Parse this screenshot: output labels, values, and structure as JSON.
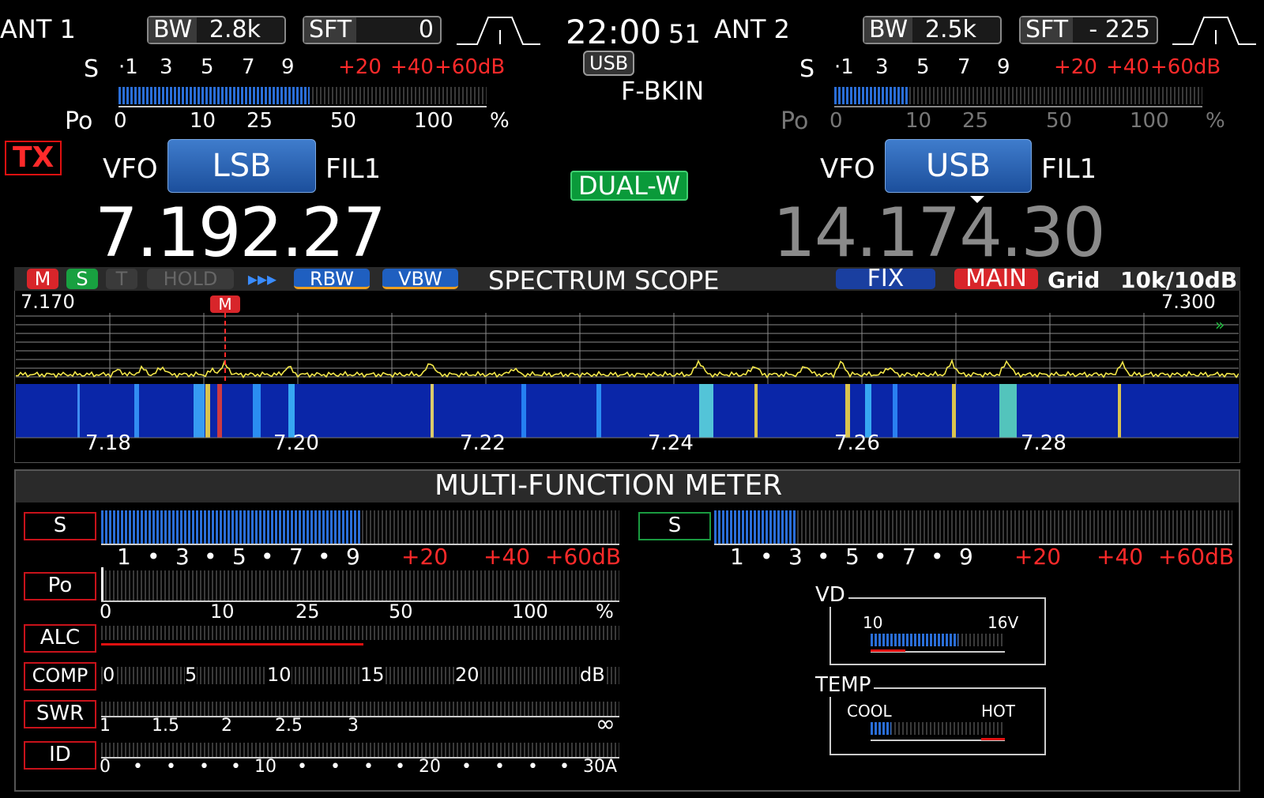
{
  "vfo_main": {
    "antenna": "ANT 1",
    "bw_label": "BW",
    "bw_value": "2.8k",
    "sft_label": "SFT",
    "sft_value": "0",
    "s_label": "S",
    "s_scale": [
      "·1",
      "·",
      "3",
      "·",
      "5",
      "·",
      "7",
      "·",
      "9"
    ],
    "s_scale_red": [
      "+20",
      "+40",
      "+60dB"
    ],
    "po_label": "Po",
    "po_scale": [
      "0",
      "10",
      "25",
      "50",
      "100",
      "%"
    ],
    "tx_badge": "TX",
    "vfo_label": "VFO",
    "mode": "LSB",
    "filter": "FIL1",
    "frequency": "7.192.27",
    "s_level": 0.52
  },
  "vfo_sub": {
    "antenna": "ANT 2",
    "bw_label": "BW",
    "bw_value": "2.5k",
    "sft_label": "SFT",
    "sft_value": "- 225",
    "s_label": "S",
    "s_scale": [
      "·1",
      "·",
      "3",
      "·",
      "5",
      "·",
      "7",
      "·",
      "9"
    ],
    "s_scale_red": [
      "+20",
      "+40",
      "+60dB"
    ],
    "po_label": "Po",
    "po_scale": [
      "0",
      "10",
      "25",
      "50",
      "100",
      "%"
    ],
    "vfo_label": "VFO",
    "mode": "USB",
    "filter": "FIL1",
    "frequency": "14.174.30",
    "s_level": 0.2
  },
  "center": {
    "time": "22:00",
    "seconds": "51",
    "mode_badge": "USB",
    "bk_mode": "F-BKIN",
    "dualwatch": "DUAL-W"
  },
  "scope": {
    "tags": {
      "m": "M",
      "s": "S",
      "t": "T",
      "hold": "HOLD",
      "speed": "▸▸▸",
      "rbw": "RBW",
      "vbw": "VBW",
      "fix": "FIX",
      "main": "MAIN"
    },
    "title": "SPECTRUM SCOPE",
    "grid_label": "Grid",
    "span": "10k/10dB",
    "start": "7.170",
    "end": "7.300",
    "marker": "M",
    "axis": [
      "7.18",
      "7.20",
      "7.22",
      "7.24",
      "7.26",
      "7.28"
    ],
    "arrows": "»"
  },
  "meter": {
    "title": "MULTI-FUNCTION METER",
    "s_main": {
      "label": "S",
      "scale": [
        "1",
        "•",
        "3",
        "•",
        "5",
        "•",
        "7",
        "•",
        "9"
      ],
      "scale_red": [
        "+20",
        "+40",
        "+60dB"
      ],
      "level": 0.5
    },
    "s_sub": {
      "label": "S",
      "scale": [
        "1",
        "•",
        "3",
        "•",
        "5",
        "•",
        "7",
        "•",
        "9"
      ],
      "scale_red": [
        "+20",
        "+40",
        "+60dB"
      ],
      "level": 0.16
    },
    "po": {
      "label": "Po",
      "scale": [
        "0",
        "10",
        "25",
        "50",
        "100",
        "%"
      ]
    },
    "alc": {
      "label": "ALC"
    },
    "comp": {
      "label": "COMP",
      "scale": [
        "0",
        "5",
        "10",
        "15",
        "20",
        "dB"
      ]
    },
    "swr": {
      "label": "SWR",
      "scale": [
        "1",
        "1.5",
        "2",
        "2.5",
        "3",
        "∞"
      ]
    },
    "id": {
      "label": "ID",
      "scale": [
        "0",
        "•",
        "•",
        "•",
        "•",
        "10",
        "•",
        "•",
        "•",
        "•",
        "20",
        "•",
        "•",
        "•",
        "•",
        "30A"
      ]
    },
    "vd": {
      "label": "VD",
      "min": "10",
      "max": "16V",
      "level": 0.65
    },
    "temp": {
      "label": "TEMP",
      "min": "COOL",
      "max": "HOT",
      "level": 0.15
    }
  }
}
